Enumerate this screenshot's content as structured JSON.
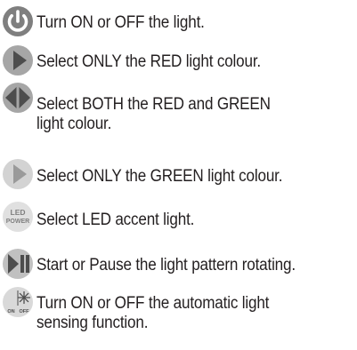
{
  "items": [
    {
      "icon": "power-icon",
      "text": "Turn ON or OFF the light."
    },
    {
      "icon": "red-only-icon",
      "text": "Select ONLY the RED light colour."
    },
    {
      "icon": "red-and-green-icon",
      "lines": [
        "Select BOTH the RED and GREEN",
        "light colour."
      ]
    },
    {
      "icon": "green-only-icon",
      "text": "Select ONLY the GREEN light colour."
    },
    {
      "icon": "led-power-icon",
      "icon_label": [
        "LED",
        "POWER"
      ],
      "text": "Select LED accent light."
    },
    {
      "icon": "play-pause-icon",
      "text": "Start or Pause the light pattern rotating."
    },
    {
      "icon": "light-sensor-icon",
      "icon_label": [
        "ON",
        "OFF"
      ],
      "lines": [
        "Turn ON or OFF the automatic light",
        "sensing function."
      ]
    }
  ],
  "colors": {
    "text": "#231f20",
    "power_icon_fill": "#7f7f7f",
    "button_icon_fill": "#a6a6a6",
    "button_icon_dark": "#4d4d4d"
  }
}
